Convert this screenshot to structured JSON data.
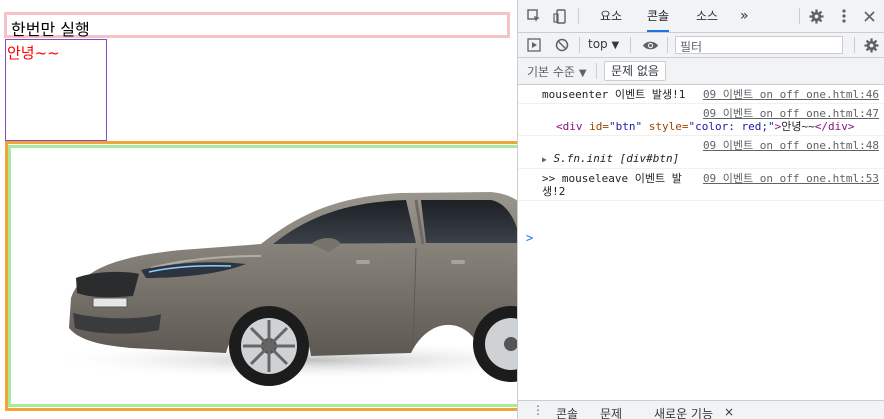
{
  "page": {
    "once_label": "한번만 실행",
    "btn_text": "안녕~~"
  },
  "devtools": {
    "tabs": [
      "요소",
      "콘솔",
      "소스"
    ],
    "active_tab": "콘솔",
    "more": "»",
    "context": "top",
    "filter_placeholder": "필터",
    "level": "기본 수준",
    "issues": "문제 없음",
    "messages": [
      {
        "text": "mouseenter 이벤트 발생!1",
        "source": "09 이벤트 on off one.html:46"
      },
      {
        "source": "09 이벤트 on off one.html:47",
        "html_open": "<div ",
        "attr1_name": "id=",
        "attr1_val": "\"btn\"",
        "attr2_name": " style=",
        "attr2_val": "\"color: red;\"",
        "html_mid": ">",
        "inner": "안녕~~",
        "html_close": "</div>"
      },
      {
        "source": "09 이벤트 on off one.html:48",
        "object": "S.fn.init [div#btn]"
      },
      {
        "text": ">> mouseleave 이벤트 발생!2",
        "source": "09 이벤트 on off one.html:53"
      }
    ],
    "prompt": ">",
    "drawer_tabs": [
      "콘솔",
      "문제",
      "새로운 기능"
    ],
    "drawer_close": "×"
  }
}
